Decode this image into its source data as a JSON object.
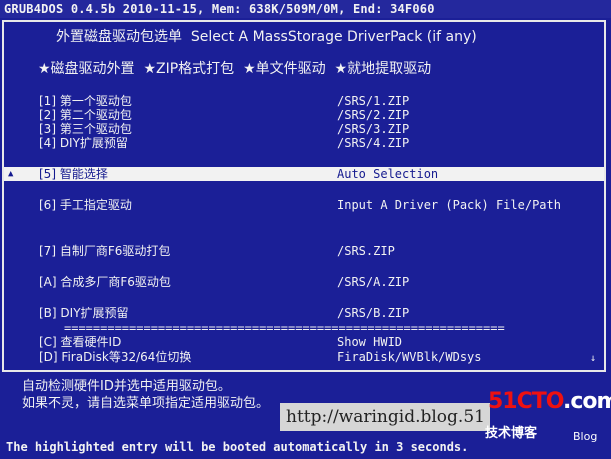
{
  "status_bar": "GRUB4DOS 0.4.5b 2010-11-15, Mem: 638K/509M/0M, End: 34F060",
  "menu": {
    "title": "外置磁盘驱动包选单  Select A MassStorage DriverPack (if any)",
    "features": "★磁盘驱动外置  ★ZIP格式打包  ★单文件驱动  ★就地提取驱动",
    "entries": [
      {
        "label": "[1] 第一个驱动包",
        "value": "/SRS/1.ZIP"
      },
      {
        "label": "[2] 第二个驱动包",
        "value": "/SRS/2.ZIP"
      },
      {
        "label": "[3] 第三个驱动包",
        "value": "/SRS/3.ZIP"
      },
      {
        "label": "[4] DIY扩展预留",
        "value": "/SRS/4.ZIP"
      },
      {
        "label": "[5] 智能选择",
        "value": "Auto Selection"
      },
      {
        "label": "[6] 手工指定驱动",
        "value": "Input A Driver (Pack) File/Path"
      },
      {
        "label": "[7] 自制厂商F6驱动打包",
        "value": "/SRS.ZIP"
      },
      {
        "label": "[A] 合成多厂商F6驱动包",
        "value": "/SRS/A.ZIP"
      },
      {
        "label": "[B] DIY扩展预留",
        "value": "/SRS/B.ZIP"
      },
      {
        "label": "[C] 查看硬件ID",
        "value": "Show HWID"
      },
      {
        "label": "[D] FiraDisk等32/64位切换",
        "value": "FiraDisk/WVBlk/WDsys"
      }
    ],
    "separator": "=============================================================",
    "up_arrow": "▲",
    "down_arrow": "↓"
  },
  "footnotes": [
    "自动检测硬件ID并选中适用驱动包。",
    "如果不灵，请自选菜单项指定适用驱动包。"
  ],
  "bottom_message": "The highlighted entry will be booted automatically in 3 seconds.",
  "watermark": {
    "url": "http://waringid.blog.51",
    "logo_main": "51CTO",
    "logo_suffix": ".com",
    "logo_sub": "技术博客",
    "logo_blog": "Blog"
  }
}
